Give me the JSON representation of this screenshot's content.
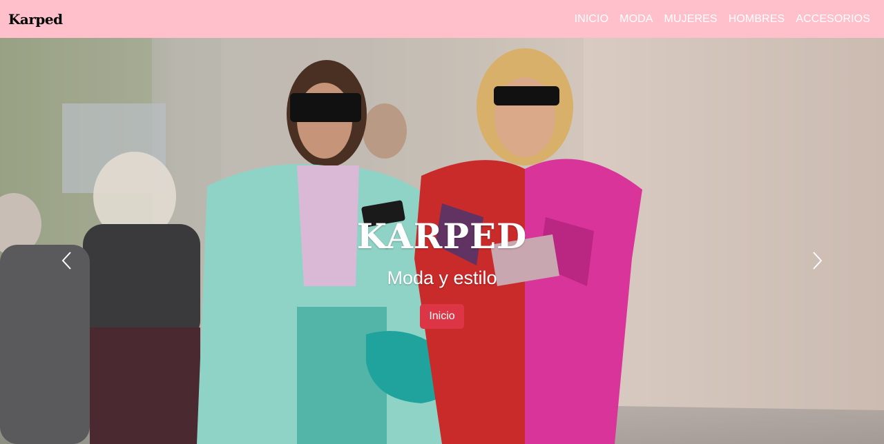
{
  "navbar": {
    "brand": "Karped",
    "links": [
      "INICIO",
      "MODA",
      "MUJERES",
      "HOMBRES",
      "ACCESORIOS"
    ],
    "background": "#ffc0cb",
    "link_color": "#ffffff"
  },
  "hero": {
    "title": "KARPED",
    "subtitle": "Moda y estilo",
    "button_label": "Inicio",
    "button_color": "#dc3545",
    "prev_icon": "chevron-left-icon",
    "next_icon": "chevron-right-icon"
  }
}
